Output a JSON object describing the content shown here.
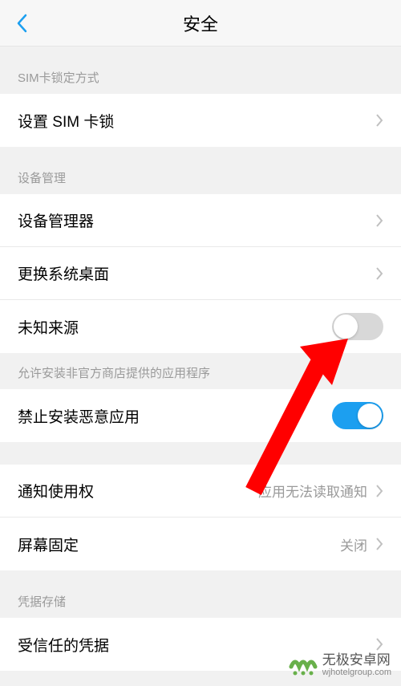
{
  "header": {
    "title": "安全"
  },
  "sections": {
    "sim": {
      "header": "SIM卡锁定方式",
      "items": {
        "setSimLock": {
          "label": "设置 SIM 卡锁"
        }
      }
    },
    "device": {
      "header": "设备管理",
      "items": {
        "deviceAdmin": {
          "label": "设备管理器"
        },
        "changeLauncher": {
          "label": "更换系统桌面"
        },
        "unknownSources": {
          "label": "未知来源"
        }
      },
      "footer": "允许安装非官方商店提供的应用程序",
      "items2": {
        "blockMalicious": {
          "label": "禁止安装恶意应用"
        }
      }
    },
    "other": {
      "items": {
        "notificationAccess": {
          "label": "通知使用权",
          "value": "应用无法读取通知"
        },
        "screenPinning": {
          "label": "屏幕固定",
          "value": "关闭"
        }
      }
    },
    "credentials": {
      "header": "凭据存储",
      "items": {
        "trustedCredentials": {
          "label": "受信任的凭据"
        }
      }
    }
  },
  "watermark": {
    "title": "无极安卓网",
    "url": "wjhotelgroup.com"
  },
  "colors": {
    "accent": "#1c9ff0",
    "arrow": "#ff0000"
  }
}
